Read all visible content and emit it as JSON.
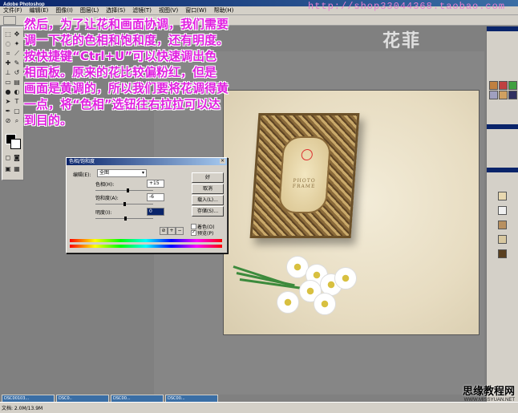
{
  "app": {
    "title": "Adobe Photoshop",
    "menus": [
      "文件(F)",
      "编辑(E)",
      "图像(I)",
      "图层(L)",
      "选择(S)",
      "滤镜(T)",
      "视图(V)",
      "窗口(W)",
      "帮助(H)"
    ]
  },
  "overlay": {
    "url": "http://shop33044368.taobao.com",
    "watermark": "花菲",
    "instruction_lines": [
      "然后，为了让花和画面协调，我们需要",
      "调一下花的色相和饱和度，还有明度。",
      "按快捷键“Ctrl+U”可以快速调出色",
      "相面板。原来的花比较偏粉红，但是",
      "画面是黄调的，所以我们要将花调得黄",
      "一点，将“色相”选钮往右拉拉可以达",
      "到目的。"
    ]
  },
  "canvas": {
    "frame_text": "PHOTO FRAME"
  },
  "dialog": {
    "title": "色相/饱和度",
    "edit_label": "编辑(E):",
    "edit_value": "全图",
    "hue_label": "色相(H):",
    "hue_value": "+15",
    "hue_fraction": 0.54,
    "saturation_label": "饱和度(A):",
    "saturation_value": "-6",
    "saturation_fraction": 0.48,
    "lightness_label": "明度(I):",
    "lightness_value": "0",
    "lightness_fraction": 0.5,
    "buttons": [
      "好",
      "取消",
      "载入(L)...",
      "存储(S)..."
    ],
    "colorize_label": "着色(O)",
    "preview_label": "预览(P)"
  },
  "statusbar": {
    "text": "文档: 2.0M/13.9M",
    "tasks": [
      "DSC00103...",
      "DSC0..",
      "DSC00...",
      "DSC00..."
    ]
  },
  "brand": {
    "name": "思缘教程网",
    "url": "WWW.MISSYUAN.NET"
  },
  "colors": {
    "overlay_text": "#e020e0",
    "url_text": "#e87fd0"
  }
}
